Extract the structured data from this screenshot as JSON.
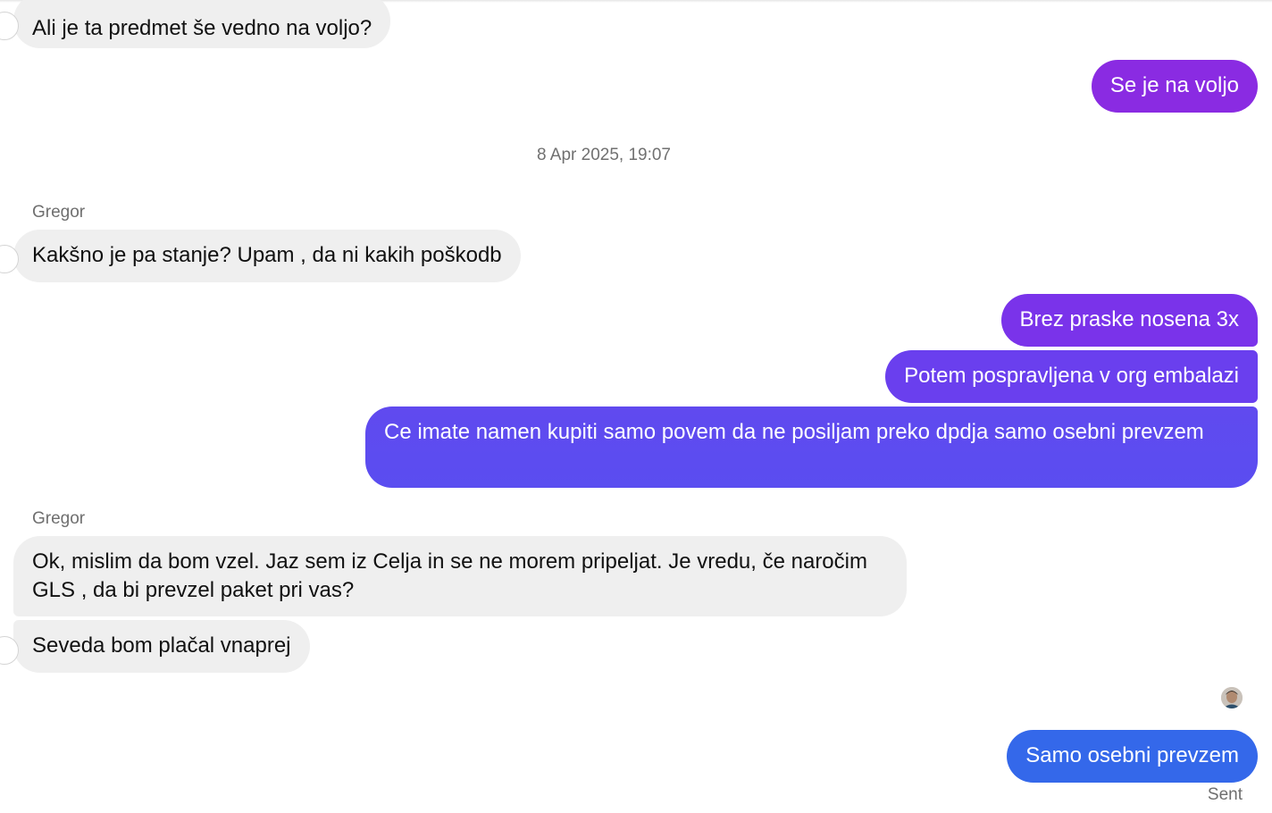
{
  "conversation": {
    "timestamp": "8 Apr 2025, 19:07",
    "sender_name": "Gregor",
    "messages": [
      {
        "text": "Ali je ta predmet še vedno na voljo?"
      },
      {
        "text": "Se je na voljo"
      },
      {
        "text": "Kakšno je pa stanje? Upam , da ni kakih poškodb"
      },
      {
        "text": "Brez praske nosena 3x"
      },
      {
        "text": "Potem pospravljena v org embalazi"
      },
      {
        "text": "Ce imate namen kupiti samo povem da ne posiljam preko dpdja samo osebni prevzem"
      },
      {
        "text": "Ok, mislim da bom vzel. Jaz sem iz Celja in se ne morem pripeljat. Je vredu, če naročim GLS , da bi prevzel paket pri vas?"
      },
      {
        "text": "Seveda bom plačal vnaprej"
      },
      {
        "text": "Samo osebni prevzem"
      }
    ],
    "status": "Sent"
  },
  "colors": {
    "incoming_bubble": "#efefef",
    "outgoing_top": "#8a2be2",
    "outgoing_middle": "#5e4bef",
    "outgoing_bottom": "#3468ea"
  },
  "icons": {
    "seen_avatar": "user-avatar-icon"
  }
}
